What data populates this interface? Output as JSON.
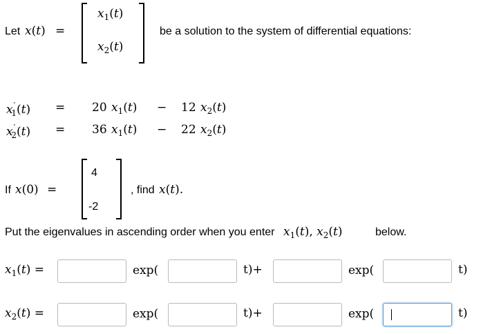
{
  "intro": {
    "let_text": "Let",
    "x_of_t": "x(t)",
    "equals": "=",
    "vector_entries": [
      "x1(t)",
      "x2(t)"
    ],
    "tail_text": "be a solution to the system of differential equations:"
  },
  "system": [
    {
      "lhs": "x1'(t)",
      "eq": "=",
      "coef1": "20",
      "var1": "x1(t)",
      "op": "−",
      "coef2": "12",
      "var2": "x2(t)"
    },
    {
      "lhs": "x2'(t)",
      "eq": "=",
      "coef1": "36",
      "var1": "x1(t)",
      "op": "−",
      "coef2": "22",
      "var2": "x2(t)"
    }
  ],
  "initial": {
    "if_text": "If",
    "x_of_0": "x(0)",
    "equals": "=",
    "values": [
      "4",
      "-2"
    ],
    "find_text": ", find",
    "target": "x(t)."
  },
  "instruction": {
    "text": "Put the eigenvalues in ascending order when you enter",
    "vars": "x1(t), x2(t)",
    "tail": "below."
  },
  "answers": [
    {
      "label": "x1(t) =",
      "exp1": "exp(",
      "mid": "t)+",
      "exp2": "exp(",
      "end": "t)",
      "values": [
        "",
        "",
        "",
        ""
      ]
    },
    {
      "label": "x2(t) =",
      "exp1": "exp(",
      "mid": "t)+",
      "exp2": "exp(",
      "end": "t)",
      "values": [
        "",
        "",
        "",
        ""
      ]
    }
  ]
}
